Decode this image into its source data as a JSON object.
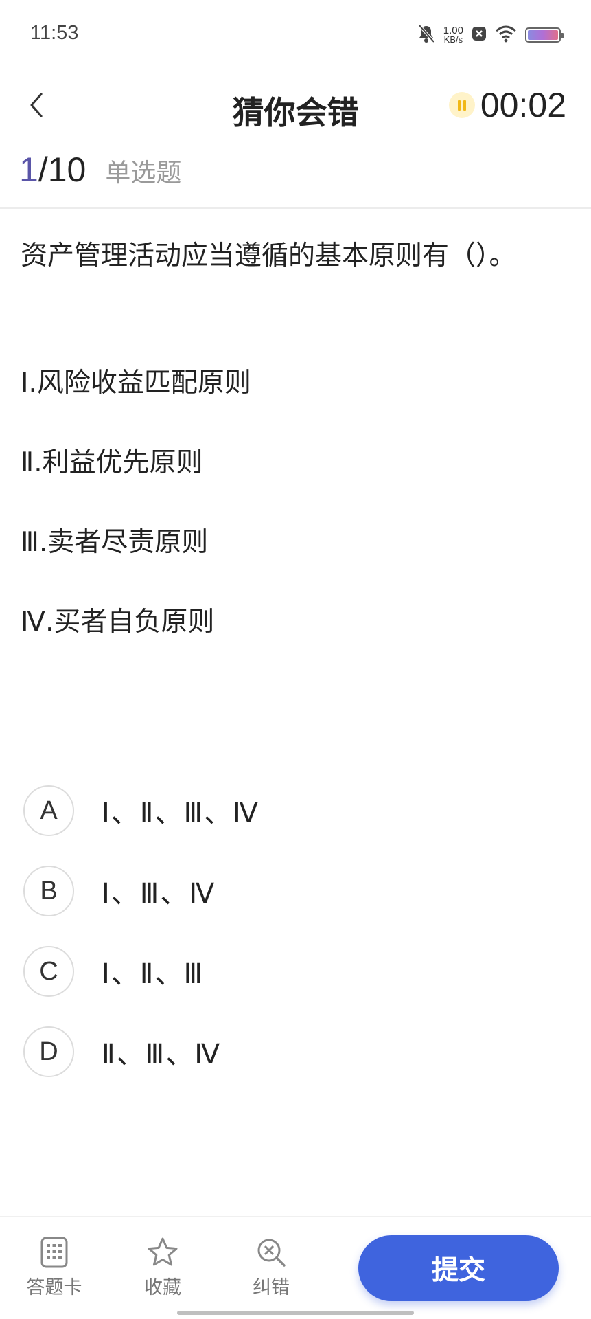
{
  "status_bar": {
    "time": "11:53",
    "net_speed_value": "1.00",
    "net_speed_unit": "KB/s",
    "icons": [
      "mute-bell-icon",
      "close-box-icon",
      "wifi-icon",
      "battery-icon"
    ]
  },
  "nav": {
    "back_icon": "chevron-left-icon",
    "title": "猜你会错",
    "timer": "00:02",
    "pause_icon": "pause-icon"
  },
  "progress": {
    "current": "1",
    "separator": "/",
    "total": "10",
    "question_type": "单选题"
  },
  "question": {
    "stem": "资产管理活动应当遵循的基本原则有（）。",
    "statements": [
      "Ⅰ.风险收益匹配原则",
      "Ⅱ.利益优先原则",
      "Ⅲ.卖者尽责原则",
      "Ⅳ.买者自负原则"
    ]
  },
  "options": [
    {
      "letter": "A",
      "text": "Ⅰ、Ⅱ、Ⅲ、Ⅳ"
    },
    {
      "letter": "B",
      "text": "Ⅰ、Ⅲ、Ⅳ"
    },
    {
      "letter": "C",
      "text": "Ⅰ、Ⅱ、Ⅲ"
    },
    {
      "letter": "D",
      "text": "Ⅱ、Ⅲ、Ⅳ"
    }
  ],
  "bottom_bar": {
    "answer_card_label": "答题卡",
    "favorite_label": "收藏",
    "correction_label": "纠错",
    "submit_label": "提交"
  },
  "colors": {
    "accent": "#3f64de",
    "progress_current": "#5a55a8",
    "timer_icon": "#f1b817"
  }
}
